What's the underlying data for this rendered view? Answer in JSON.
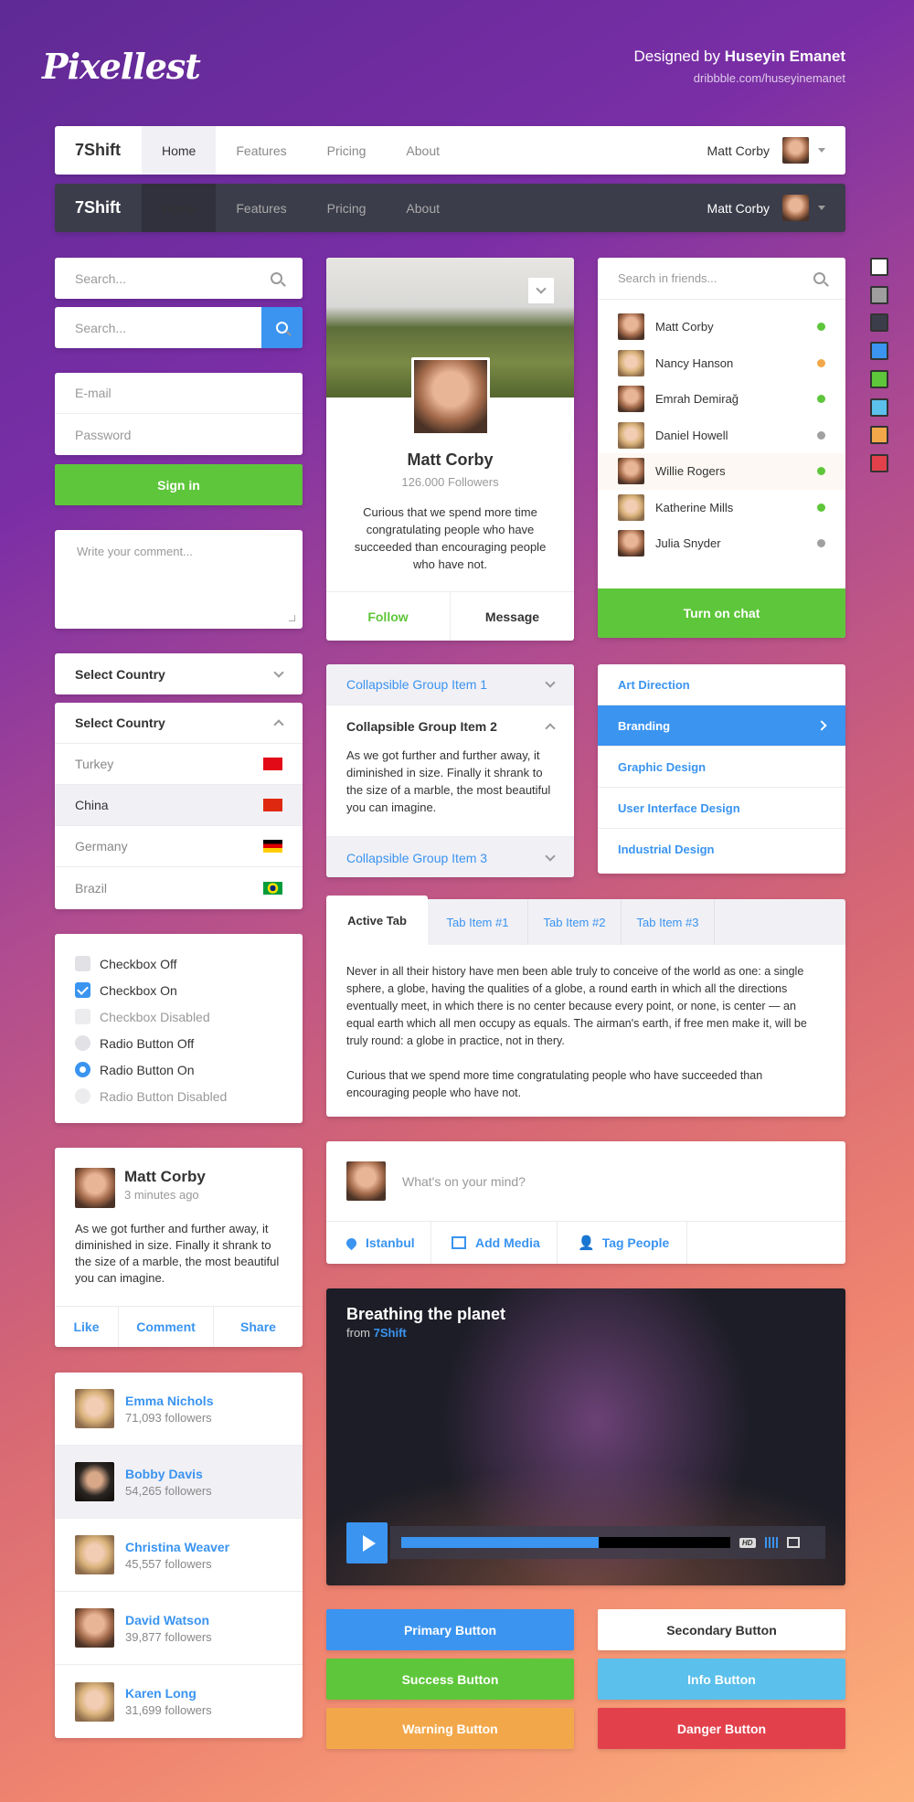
{
  "header": {
    "logo": "Pixellest",
    "designed_by": "Designed by",
    "designer": "Huseyin Emanet",
    "link": "dribbble.com/huseyinemanet"
  },
  "navbar": {
    "brand": "7Shift",
    "items": [
      "Home",
      "Features",
      "Pricing",
      "About"
    ],
    "active": "Home",
    "user": "Matt Corby"
  },
  "search": {
    "placeholder1": "Search...",
    "placeholder2": "Search..."
  },
  "login": {
    "email_placeholder": "E-mail",
    "password_placeholder": "Password",
    "sign_in": "Sign in"
  },
  "comment": {
    "placeholder": "Write your comment..."
  },
  "select_closed": {
    "label": "Select Country"
  },
  "select_open": {
    "label": "Select Country",
    "options": [
      {
        "name": "Turkey",
        "flag": "turkey-flag"
      },
      {
        "name": "China",
        "flag": "china-flag",
        "selected": true
      },
      {
        "name": "Germany",
        "flag": "germany-flag"
      },
      {
        "name": "Brazil",
        "flag": "brazil-flag"
      }
    ]
  },
  "controls": [
    {
      "type": "checkbox",
      "label": "Checkbox Off",
      "state": "off"
    },
    {
      "type": "checkbox",
      "label": "Checkbox On",
      "state": "on"
    },
    {
      "type": "checkbox",
      "label": "Checkbox Disabled",
      "state": "disabled"
    },
    {
      "type": "radio",
      "label": "Radio Button Off",
      "state": "off"
    },
    {
      "type": "radio",
      "label": "Radio Button On",
      "state": "on"
    },
    {
      "type": "radio",
      "label": "Radio Button Disabled",
      "state": "disabled"
    }
  ],
  "post": {
    "name": "Matt Corby",
    "time": "3 minutes ago",
    "text": "As we got further and further away, it diminished in size. Finally it shrank to the size of a marble, the most beautiful you can imagine.",
    "actions": [
      "Like",
      "Comment",
      "Share"
    ]
  },
  "followers": [
    {
      "name": "Emma Nichols",
      "count": "71,093 followers"
    },
    {
      "name": "Bobby Davis",
      "count": "54,265 followers",
      "highlighted": true
    },
    {
      "name": "Christina Weaver",
      "count": "45,557 followers"
    },
    {
      "name": "David Watson",
      "count": "39,877 followers"
    },
    {
      "name": "Karen Long",
      "count": "31,699 followers"
    }
  ],
  "profile": {
    "name": "Matt Corby",
    "followers": "126.000 Followers",
    "bio": "Curious that we spend more time congratulating people who have succeeded than encouraging people who have not.",
    "follow": "Follow",
    "message": "Message"
  },
  "friends": {
    "placeholder": "Search in friends...",
    "list": [
      {
        "name": "Matt Corby",
        "status": "online"
      },
      {
        "name": "Nancy Hanson",
        "status": "away"
      },
      {
        "name": "Emrah Demirağ",
        "status": "online"
      },
      {
        "name": "Daniel Howell",
        "status": "offline"
      },
      {
        "name": "Willie Rogers",
        "status": "online",
        "highlighted": true
      },
      {
        "name": "Katherine Mills",
        "status": "online"
      },
      {
        "name": "Julia Snyder",
        "status": "offline"
      }
    ],
    "button": "Turn on chat"
  },
  "status_colors": {
    "online": "#5ec63a",
    "away": "#f2a84a",
    "offline": "#a0a0a0"
  },
  "swatches": [
    "#ffffff",
    "#9e9e9e",
    "#3c3d4a",
    "#3a94f0",
    "#5ec63a",
    "#5bc0eb",
    "#f2a84a",
    "#e2414c"
  ],
  "accordion": [
    {
      "title": "Collapsible Group Item 1",
      "open": false
    },
    {
      "title": "Collapsible Group Item 2",
      "open": true,
      "body": "As we got further and further away, it diminished in size. Finally it shrank to the size of a marble, the most beautiful you can imagine."
    },
    {
      "title": "Collapsible Group Item 3",
      "open": false
    }
  ],
  "menu": {
    "items": [
      "Art Direction",
      "Branding",
      "Graphic Design",
      "User Interface Design",
      "Industrial Design"
    ],
    "active": "Branding"
  },
  "tabs": {
    "items": [
      "Active Tab",
      "Tab Item #1",
      "Tab Item #2",
      "Tab Item #3"
    ],
    "p1": "Never in all their history have men been able truly to conceive of the world as one: a single sphere, a globe, having the qualities of a globe, a round earth in which all the directions eventually meet, in which there is no center because every point, or none, is center — an equal earth which all men occupy as equals. The airman's earth, if free men make it, will be truly round: a globe in practice, not in thery.",
    "p2": "Curious that we spend more time congratulating people who have succeeded than encouraging people who have not."
  },
  "composer": {
    "placeholder": "What's on your mind?",
    "actions": [
      {
        "label": "Istanbul",
        "icon": "location-pin-icon"
      },
      {
        "label": "Add Media",
        "icon": "image-icon"
      },
      {
        "label": "Tag People",
        "icon": "add-person-icon"
      }
    ]
  },
  "video": {
    "title": "Breathing the planet",
    "from": "from",
    "channel": "7Shift",
    "progress_percent": 60,
    "hd": "HD"
  },
  "buttons": {
    "primary": "Primary Button",
    "secondary": "Secondary Button",
    "success": "Success Button",
    "info": "Info Button",
    "warning": "Warning Button",
    "danger": "Danger Button"
  },
  "colors": {
    "primary": "#3a94f0",
    "success": "#5ec63a",
    "info": "#5bc0eb",
    "warning": "#f2a84a",
    "danger": "#e2414c"
  }
}
